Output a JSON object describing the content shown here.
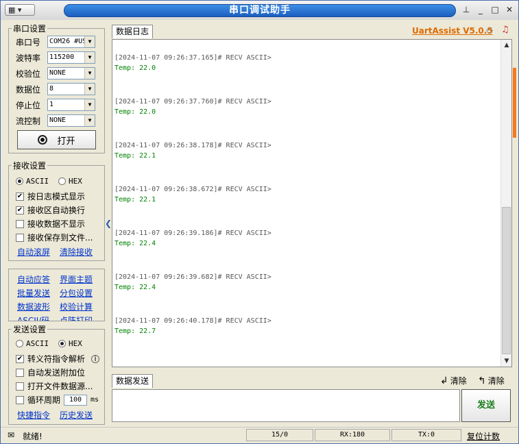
{
  "app": {
    "sys_menu": "▦ ▾",
    "title": "串口调试助手",
    "pin_icon": "pin-icon",
    "minimize": "_",
    "maximize": "□",
    "close": "✕",
    "brand": "UartAssist V5.0.5"
  },
  "serial_settings": {
    "title": "串口设置",
    "port_label": "串口号",
    "port_value": "COM26 #US",
    "baud_label": "波特率",
    "baud_value": "115200",
    "parity_label": "校验位",
    "parity_value": "NONE",
    "databits_label": "数据位",
    "databits_value": "8",
    "stopbits_label": "停止位",
    "stopbits_value": "1",
    "flow_label": "流控制",
    "flow_value": "NONE",
    "open_button": "打开"
  },
  "receive_settings": {
    "title": "接收设置",
    "ascii": "ASCII",
    "hex": "HEX",
    "log_mode": "按日志模式显示",
    "auto_wrap": "接收区自动换行",
    "no_display": "接收数据不显示",
    "save_to_file": "接收保存到文件...",
    "auto_scroll": "自动滚屏",
    "clear_recv": "清除接收"
  },
  "tools": {
    "auto_reply": "自动应答",
    "theme": "界面主题",
    "batch_send": "批量发送",
    "packet_settings": "分包设置",
    "waveform": "数据波形",
    "checksum": "校验计算",
    "ascii_table": "ASCII/码",
    "dot_matrix": "点阵打印"
  },
  "send_settings": {
    "title": "发送设置",
    "ascii": "ASCII",
    "hex": "HEX",
    "escape_parse": "转义符指令解析",
    "auto_append": "自动发送附加位",
    "open_file": "打开文件数据源...",
    "cycle": "循环周期",
    "cycle_value": "100",
    "cycle_unit": "ms",
    "shortcut": "快捷指令",
    "history": "历史发送"
  },
  "log": {
    "tab": "数据日志",
    "entries": [
      {
        "head": "[2024-11-07 09:26:37.165]# RECV ASCII>",
        "value": "Temp: 22.0"
      },
      {
        "head": "[2024-11-07 09:26:37.760]# RECV ASCII>",
        "value": "Temp: 22.0"
      },
      {
        "head": "[2024-11-07 09:26:38.178]# RECV ASCII>",
        "value": "Temp: 22.1"
      },
      {
        "head": "[2024-11-07 09:26:38.672]# RECV ASCII>",
        "value": "Temp: 22.1"
      },
      {
        "head": "[2024-11-07 09:26:39.186]# RECV ASCII>",
        "value": "Temp: 22.4"
      },
      {
        "head": "[2024-11-07 09:26:39.682]# RECV ASCII>",
        "value": "Temp: 22.4"
      },
      {
        "head": "[2024-11-07 09:26:40.178]# RECV ASCII>",
        "value": "Temp: 22.7"
      }
    ]
  },
  "send": {
    "tab": "数据发送",
    "clear1": "清除",
    "clear2": "清除",
    "send_button": "发送"
  },
  "status": {
    "ready": "就绪!",
    "counter": "15/0",
    "rx": "RX:180",
    "tx": "TX:0",
    "reset_count": "复位计数"
  },
  "colors": {
    "title_blue": "#1b5fbf",
    "brand_orange": "#e06a00",
    "recv_green": "#008000"
  }
}
